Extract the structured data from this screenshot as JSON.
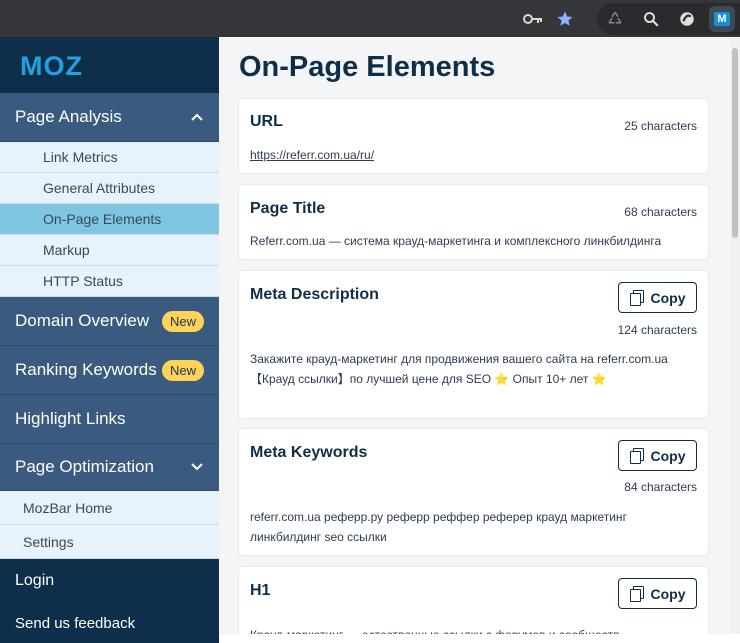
{
  "browser": {
    "icons": [
      "key-icon",
      "star-icon",
      "recycle-icon",
      "zoom-icon",
      "extension-icon",
      "mozbar-extension-icon"
    ],
    "moz_ext_letter": "M"
  },
  "sidebar": {
    "logo": "MOZ",
    "page_analysis": {
      "label": "Page Analysis",
      "items": [
        {
          "label": "Link Metrics"
        },
        {
          "label": "General Attributes"
        },
        {
          "label": "On-Page Elements"
        },
        {
          "label": "Markup"
        },
        {
          "label": "HTTP Status"
        }
      ]
    },
    "domain_overview": {
      "label": "Domain Overview",
      "badge": "New"
    },
    "ranking_keywords": {
      "label": "Ranking Keywords",
      "badge": "New"
    },
    "highlight_links": {
      "label": "Highlight Links"
    },
    "page_optimization": {
      "label": "Page Optimization",
      "items": [
        {
          "label": "MozBar Home"
        },
        {
          "label": "Settings"
        }
      ]
    },
    "login": "Login",
    "feedback": "Send us feedback"
  },
  "main": {
    "title": "On-Page Elements",
    "copy_label": "Copy",
    "cards": {
      "url": {
        "title": "URL",
        "count": "25 characters",
        "value": "https://referr.com.ua/ru/"
      },
      "page_title": {
        "title": "Page Title",
        "count": "68 characters",
        "value": "Referr.com.ua — система крауд-маркетинга и комплексного линкбилдинга"
      },
      "meta_description": {
        "title": "Meta Description",
        "count": "124 characters",
        "value": "Закажите крауд-маркетинг для продвижения вашего сайта на referr.com.ua【Крауд ссылки】по лучшей цене для SEO ⭐ Опыт 10+ лет ⭐"
      },
      "meta_keywords": {
        "title": "Meta Keywords",
        "count": "84 characters",
        "value": "referr.com.ua реферр.ру реферр реффер реферер крауд маркетинг линкбилдинг seo ссылки"
      },
      "h1": {
        "title": "H1",
        "value": "Крауд-маркетинг — естественные ссылки с форумов и сообществ"
      }
    }
  },
  "colors": {
    "sidebar_bg": "#1c3450",
    "logo_bg": "#0f2e4a",
    "active_section": "#3a5a80",
    "selected_item": "#80c6e0",
    "badge": "#ffd35a",
    "accent": "#1a8fd6"
  }
}
